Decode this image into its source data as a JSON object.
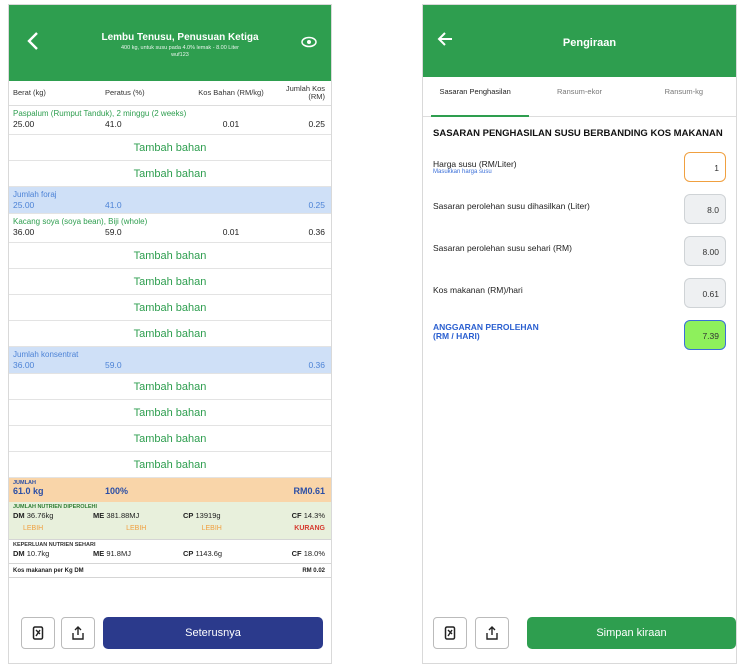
{
  "left": {
    "header": {
      "title": "Lembu Tenusu, Penusuan Ketiga",
      "subtitle": "400 kg, untuk susu pada 4.0% lemak - 8.00 Liter",
      "subtitle2": "wuf123"
    },
    "columns": [
      "Berat (kg)",
      "Peratus (%)",
      "Kos Bahan (RM/kg)",
      "Jumlah Kos (RM)"
    ],
    "ingredient1": {
      "name": "Paspalum (Rumput Tanduk), 2 minggu (2 weeks)",
      "berat": "25.00",
      "peratus": "41.0",
      "kos": "0.01",
      "jumlah": "0.25"
    },
    "add_label": "Tambah bahan",
    "forage_total": {
      "name": "Jumlah foraj",
      "berat": "25.00",
      "peratus": "41.0",
      "jumlah": "0.25"
    },
    "ingredient2": {
      "name": "Kacang soya (soya bean), Biji (whole)",
      "berat": "36.00",
      "peratus": "59.0",
      "kos": "0.01",
      "jumlah": "0.36"
    },
    "conc_total": {
      "name": "Jumlah konsentrat",
      "berat": "36.00",
      "peratus": "59.0",
      "jumlah": "0.36"
    },
    "jumlah": {
      "label": "JUMLAH",
      "berat": "61.0 kg",
      "peratus": "100%",
      "jumlah": "RM0.61"
    },
    "nutrien": {
      "label": "JUMLAH NUTRIEN DIPEROLEHI",
      "dm_k": "DM",
      "dm_v": "36.76kg",
      "me_k": "ME",
      "me_v": "381.88MJ",
      "cp_k": "CP",
      "cp_v": "13919g",
      "cf_k": "CF",
      "cf_v": "14.3%",
      "s1": "LEBIH",
      "s2": "LEBIH",
      "s3": "LEBIH",
      "s4": "KURANG"
    },
    "keperluan": {
      "label": "KEPERLUAN NUTRIEN SEHARI",
      "dm_k": "DM",
      "dm_v": "10.7kg",
      "me_k": "ME",
      "me_v": "91.8MJ",
      "cp_k": "CP",
      "cp_v": "1143.6g",
      "cf_k": "CF",
      "cf_v": "18.0%"
    },
    "kos_label": "Kos makanan per Kg DM",
    "kos_value": "RM 0.02",
    "next_button": "Seterusnya",
    "colors": {
      "green": "#2e9e4f",
      "navy": "#2b3a8c"
    }
  },
  "right": {
    "header": {
      "title": "Pengiraan"
    },
    "tabs": [
      "Sasaran Penghasilan",
      "Ransum-ekor",
      "Ransum-kg"
    ],
    "section_title": "SASARAN PENGHASILAN SUSU BERBANDING KOS MAKANAN",
    "harga": {
      "label": "Harga susu (RM/Liter)",
      "hint": "Masukkan harga susu",
      "value": "1"
    },
    "sasaran_liter": {
      "label": "Sasaran perolehan susu dihasilkan (Liter)",
      "value": "8.0"
    },
    "sasaran_rm": {
      "label": "Sasaran perolehan susu sehari (RM)",
      "value": "8.00"
    },
    "kos": {
      "label": "Kos makanan (RM)/hari",
      "value": "0.61"
    },
    "anggaran": {
      "label1": "ANGGARAN PEROLEHAN",
      "label2": "(RM / HARI)",
      "value": "7.39"
    },
    "save_button": "Simpan kiraan"
  }
}
